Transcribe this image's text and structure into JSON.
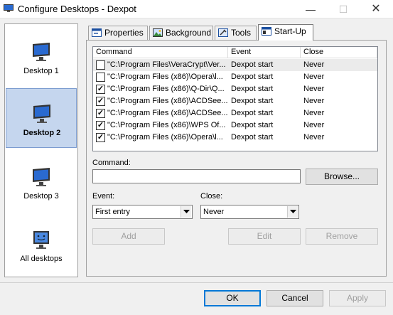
{
  "window": {
    "title": "Configure Desktops - Dexpot",
    "minimize": "—",
    "maximize": "☐",
    "close": "✕"
  },
  "desktops": [
    {
      "label": "Desktop 1",
      "selected": false
    },
    {
      "label": "Desktop 2",
      "selected": true
    },
    {
      "label": "Desktop 3",
      "selected": false
    },
    {
      "label": "All desktops",
      "selected": false
    }
  ],
  "tabs": [
    {
      "label": "Properties",
      "icon": "properties-icon"
    },
    {
      "label": "Background",
      "icon": "background-icon"
    },
    {
      "label": "Tools",
      "icon": "tools-icon"
    },
    {
      "label": "Start-Up",
      "icon": "startup-icon",
      "active": true
    }
  ],
  "list": {
    "columns": [
      "Command",
      "Event",
      "Close"
    ],
    "rows": [
      {
        "checked": false,
        "command": "\"C:\\Program Files\\VeraCrypt\\Ver...",
        "event": "Dexpot start",
        "close": "Never"
      },
      {
        "checked": false,
        "command": "\"C:\\Program Files (x86)\\Opera\\l...",
        "event": "Dexpot start",
        "close": "Never"
      },
      {
        "checked": true,
        "command": "\"C:\\Program Files (x86)\\Q-Dir\\Q...",
        "event": "Dexpot start",
        "close": "Never"
      },
      {
        "checked": true,
        "command": "\"C:\\Program Files (x86)\\ACDSee...",
        "event": "Dexpot start",
        "close": "Never"
      },
      {
        "checked": true,
        "command": "\"C:\\Program Files (x86)\\ACDSee...",
        "event": "Dexpot start",
        "close": "Never"
      },
      {
        "checked": true,
        "command": "\"C:\\Program Files (x86)\\WPS Of...",
        "event": "Dexpot start",
        "close": "Never"
      },
      {
        "checked": true,
        "command": "\"C:\\Program Files (x86)\\Opera\\l...",
        "event": "Dexpot start",
        "close": "Never"
      }
    ]
  },
  "form": {
    "command_label": "Command:",
    "command_value": "",
    "browse": "Browse...",
    "event_label": "Event:",
    "event_value": "First entry",
    "close_label": "Close:",
    "close_value": "Never",
    "add": "Add",
    "edit": "Edit",
    "remove": "Remove"
  },
  "footer": {
    "ok": "OK",
    "cancel": "Cancel",
    "apply": "Apply"
  },
  "colors": {
    "selection": "#c5d6ee",
    "accent": "#0078d7",
    "monitor": "#2a6ad0"
  }
}
